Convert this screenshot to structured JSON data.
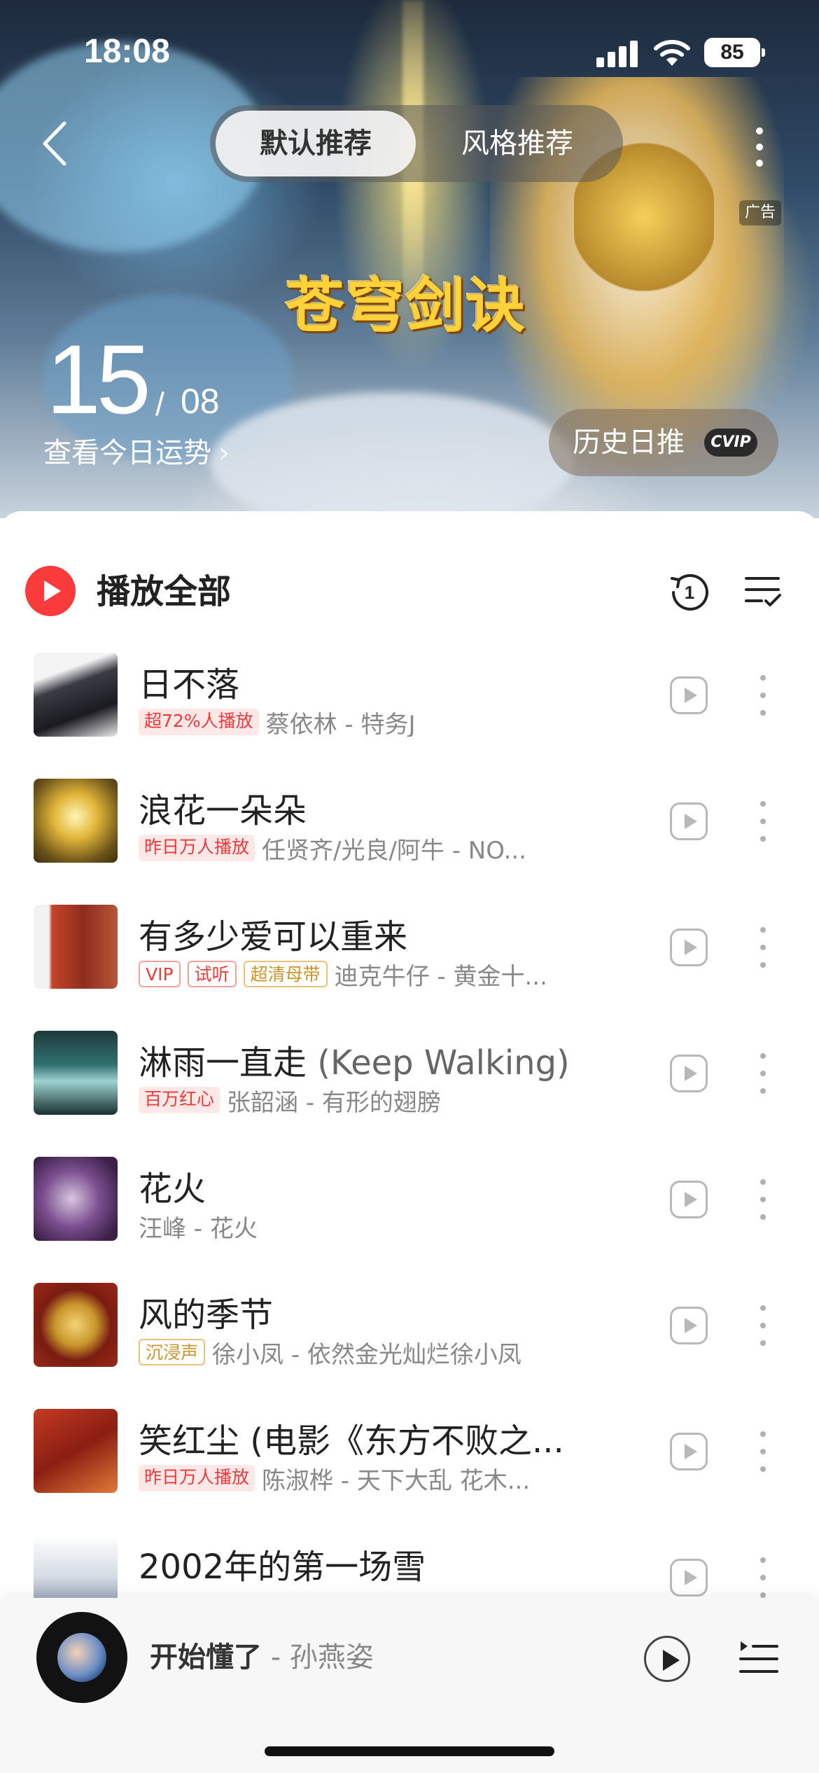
{
  "status_bar": {
    "time": "18:08",
    "battery": "85"
  },
  "header": {
    "tabs": [
      {
        "label": "默认推荐",
        "active": true
      },
      {
        "label": "风格推荐",
        "active": false
      }
    ],
    "ad_label": "广告",
    "banner_title": "苍穹剑诀",
    "date_day": "15",
    "date_separator": "/",
    "date_month": "08",
    "fortune_link": "查看今日运势",
    "history_button": {
      "label": "历史日推",
      "badge": "CVIP"
    }
  },
  "list": {
    "play_all_label": "播放全部",
    "loop_count": "1",
    "songs": [
      {
        "title": "日不落",
        "badges": [
          {
            "text": "超72%人播放",
            "style": "red"
          }
        ],
        "artist": "蔡依林 - 特务J"
      },
      {
        "title": "浪花一朵朵",
        "badges": [
          {
            "text": "昨日万人播放",
            "style": "red"
          }
        ],
        "artist": "任贤齐/光良/阿牛 - NO..."
      },
      {
        "title": "有多少爱可以重来",
        "badges": [
          {
            "text": "VIP",
            "style": "redline"
          },
          {
            "text": "试听",
            "style": "redline"
          },
          {
            "text": "超清母带",
            "style": "gold"
          }
        ],
        "artist": "迪克牛仔 - 黄金十..."
      },
      {
        "title": "淋雨一直走",
        "title_extra": " (Keep Walking)",
        "badges": [
          {
            "text": "百万红心",
            "style": "red"
          }
        ],
        "artist": "张韶涵 - 有形的翅膀"
      },
      {
        "title": "花火",
        "badges": [],
        "artist": "汪峰 - 花火"
      },
      {
        "title": "风的季节",
        "badges": [
          {
            "text": "沉浸声",
            "style": "gold"
          }
        ],
        "artist": "徐小凤 - 依然金光灿烂徐小凤"
      },
      {
        "title": "笑红尘 (电影《东方不败之...",
        "badges": [
          {
            "text": "昨日万人播放",
            "style": "red"
          }
        ],
        "artist": "陈淑桦 - 天下大乱 花木..."
      },
      {
        "title": "2002年的第一场雪",
        "badges": [],
        "artist": ""
      }
    ]
  },
  "player": {
    "track_name": "开始懂了",
    "singer": " - 孙燕姿"
  },
  "colors": {
    "accent": "#fb3b3b",
    "badge_red": "#ee3a3a",
    "badge_gold": "#c8962b"
  }
}
